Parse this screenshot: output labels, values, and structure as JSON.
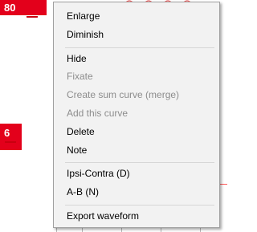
{
  "background": {
    "badge_top": "80",
    "badge_mid": "6"
  },
  "menu": {
    "items": [
      {
        "label": "Enlarge",
        "enabled": true
      },
      {
        "label": "Diminish",
        "enabled": true
      },
      {
        "label": "Hide",
        "enabled": true
      },
      {
        "label": "Fixate",
        "enabled": false
      },
      {
        "label": "Create sum curve (merge)",
        "enabled": false
      },
      {
        "label": "Add this curve",
        "enabled": false
      },
      {
        "label": "Delete",
        "enabled": true
      },
      {
        "label": "Note",
        "enabled": true
      },
      {
        "label": "Ipsi-Contra (D)",
        "enabled": true
      },
      {
        "label": "A-B (N)",
        "enabled": true
      },
      {
        "label": "Export waveform",
        "enabled": true
      }
    ]
  },
  "colors": {
    "badge": "#e3001b",
    "menu_background": "#f2f2f2",
    "disabled_text": "#8d8d8d"
  }
}
